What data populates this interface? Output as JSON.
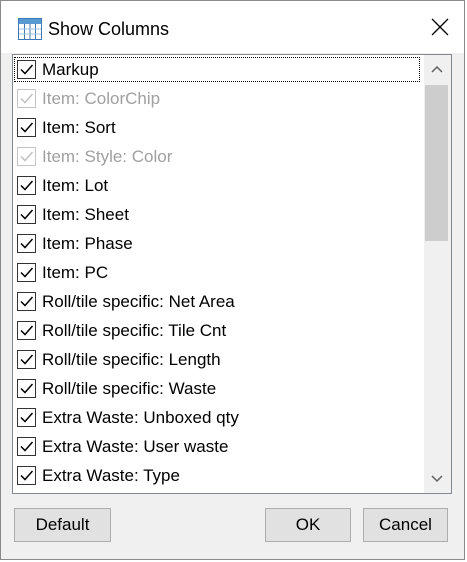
{
  "window": {
    "title": "Show Columns",
    "icon": "table-columns-icon",
    "close_icon": "close-icon"
  },
  "columns": [
    {
      "label": "Markup",
      "checked": true,
      "enabled": true
    },
    {
      "label": "Item: ColorChip",
      "checked": true,
      "enabled": false
    },
    {
      "label": "Item: Sort",
      "checked": true,
      "enabled": true
    },
    {
      "label": "Item: Style: Color",
      "checked": true,
      "enabled": false
    },
    {
      "label": "Item: Lot",
      "checked": true,
      "enabled": true
    },
    {
      "label": "Item: Sheet",
      "checked": true,
      "enabled": true
    },
    {
      "label": "Item: Phase",
      "checked": true,
      "enabled": true
    },
    {
      "label": "Item: PC",
      "checked": true,
      "enabled": true
    },
    {
      "label": "Roll/tile specific: Net Area",
      "checked": true,
      "enabled": true
    },
    {
      "label": "Roll/tile specific: Tile Cnt",
      "checked": true,
      "enabled": true
    },
    {
      "label": "Roll/tile specific: Length",
      "checked": true,
      "enabled": true
    },
    {
      "label": "Roll/tile specific: Waste",
      "checked": true,
      "enabled": true
    },
    {
      "label": "Extra Waste: Unboxed qty",
      "checked": true,
      "enabled": true
    },
    {
      "label": "Extra Waste: User waste",
      "checked": true,
      "enabled": true
    },
    {
      "label": "Extra Waste: Type",
      "checked": true,
      "enabled": true
    }
  ],
  "buttons": {
    "default": "Default",
    "ok": "OK",
    "cancel": "Cancel"
  },
  "colors": {
    "disabled_text": "#a0a0a0",
    "dialog_bg": "#f0f0f0",
    "button_bg": "#e1e1e1"
  }
}
